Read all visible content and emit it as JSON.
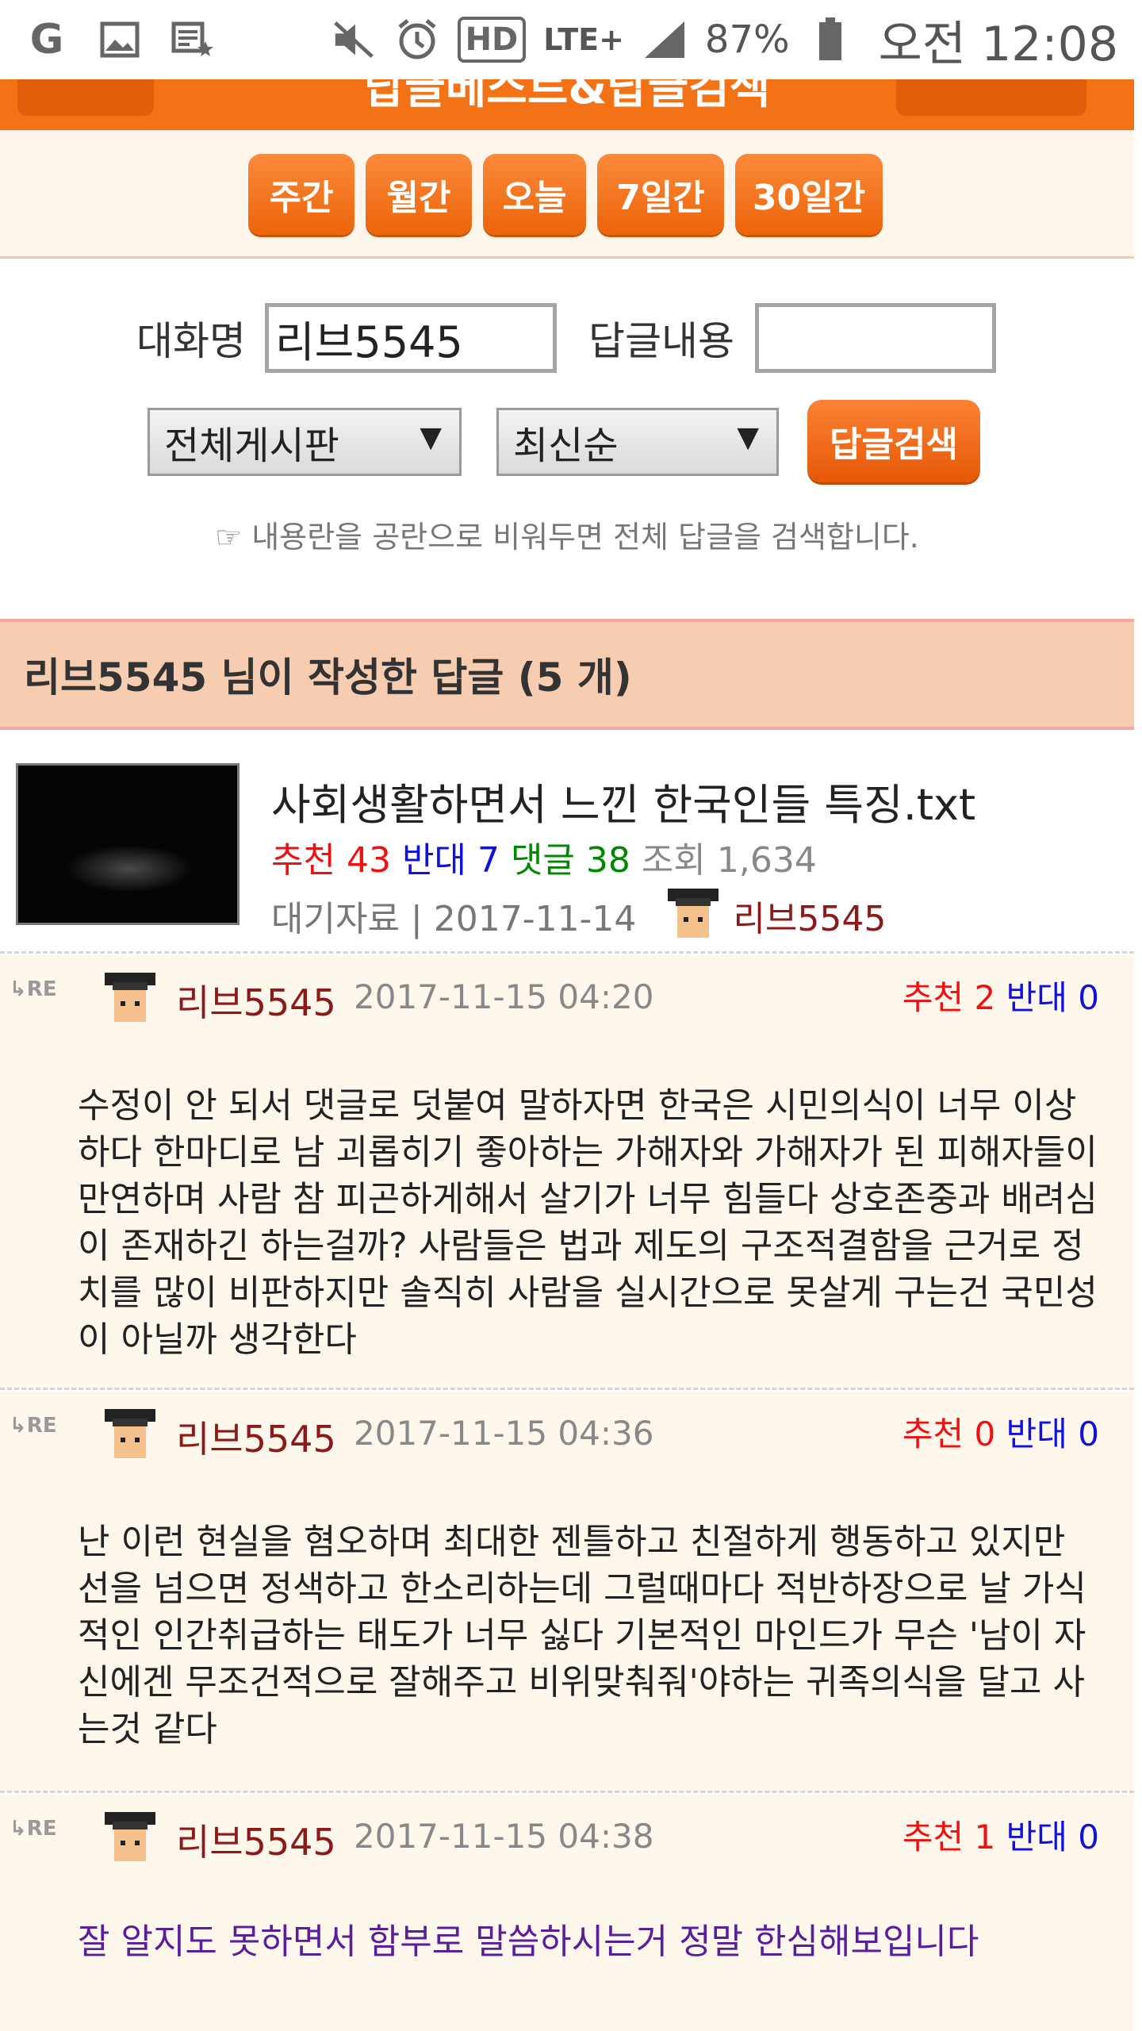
{
  "status_bar": {
    "battery": "87%",
    "time": "오전 12:08",
    "network": "LTE+",
    "hd": "HD"
  },
  "header": {
    "title": "답글베스트&답글검색"
  },
  "period_tabs": [
    {
      "label": "주간"
    },
    {
      "label": "월간"
    },
    {
      "label": "오늘"
    },
    {
      "label": "7일간"
    },
    {
      "label": "30일간"
    }
  ],
  "search": {
    "nickname_label": "대화명",
    "nickname_value": "리브5545",
    "content_label": "답글내용",
    "content_value": "",
    "board_select": "전체게시판",
    "order_select": "최신순",
    "button_label": "답글검색",
    "note": "☞ 내용란을 공란으로 비워두면 전체 답글을 검색합니다."
  },
  "result": {
    "heading": "리브5545 님이 작성한 답글 (5 개)"
  },
  "post": {
    "title": "사회생활하면서 느낀 한국인들 특징.txt",
    "recommend_label": "추천",
    "recommend": "43",
    "oppose_label": "반대",
    "oppose": "7",
    "comments_label": "댓글",
    "comments": "38",
    "views_label": "조회",
    "views": "1,634",
    "category": "대기자료 | 2017-11-14",
    "author": "리브5545"
  },
  "comments": [
    {
      "author": "리브5545",
      "date": "2017-11-15 04:20",
      "recommend_label": "추천",
      "recommend": "2",
      "oppose_label": "반대",
      "oppose": "0",
      "body": "수정이 안 되서 댓글로 덧붙여 말하자면 한국은 시민의식이 너무 이상하다 한마디로 남 괴롭히기 좋아하는 가해자와 가해자가 된 피해자들이 만연하며 사람 참 피곤하게해서 살기가 너무 힘들다 상호존중과 배려심이 존재하긴 하는걸까? 사람들은 법과 제도의 구조적결함을 근거로 정치를 많이 비판하지만 솔직히 사람을 실시간으로 못살게 구는건 국민성이 아닐까 생각한다"
    },
    {
      "author": "리브5545",
      "date": "2017-11-15 04:36",
      "recommend_label": "추천",
      "recommend": "0",
      "oppose_label": "반대",
      "oppose": "0",
      "body": "난 이런 현실을 혐오하며 최대한 젠틀하고 친절하게 행동하고 있지만 선을 넘으면 정색하고 한소리하는데 그럴때마다 적반하장으로 날 가식적인 인간취급하는 태도가 너무 싫다 기본적인 마인드가 무슨 '남이 자신에겐 무조건적으로 잘해주고 비위맞춰줘'야하는 귀족의식을 달고 사는것 같다"
    },
    {
      "author": "리브5545",
      "date": "2017-11-15 04:38",
      "recommend_label": "추천",
      "recommend": "1",
      "oppose_label": "반대",
      "oppose": "0",
      "body": "잘 알지도 못하면서 함부로 말씀하시는거 정말 한심해보입니다"
    }
  ],
  "re_label": "RE",
  "colors": {
    "accent": "#f47216",
    "recommend": "#ee1111",
    "oppose": "#1111dd",
    "comments": "#008800",
    "author": "#8b1a1a",
    "last_comment": "#5a1e9c"
  }
}
